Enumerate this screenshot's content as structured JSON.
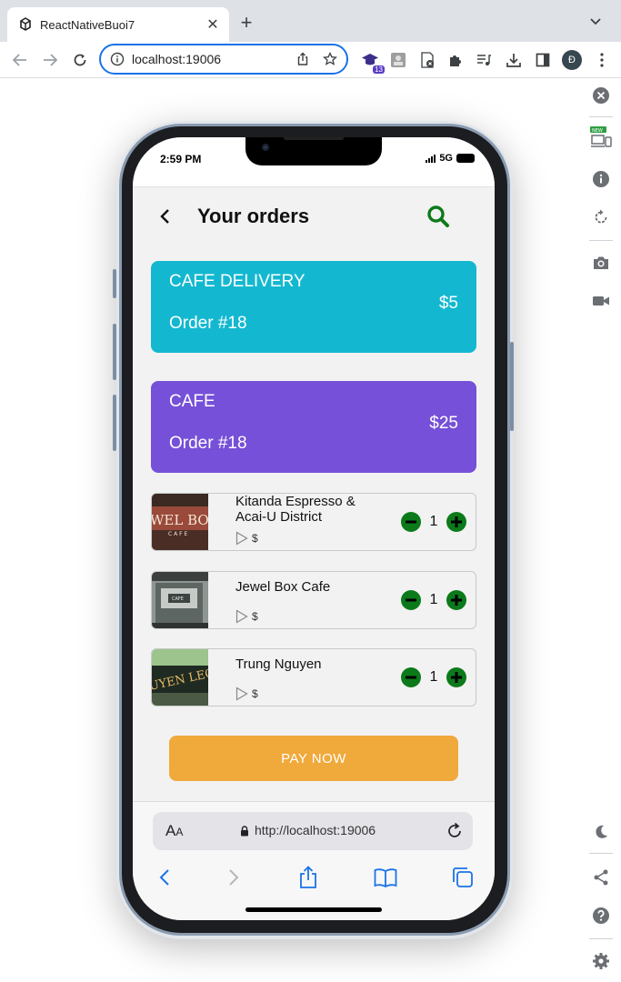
{
  "browser": {
    "tab_title": "ReactNativeBuoi7",
    "url": "localhost:19006",
    "extension_badge": "13",
    "profile_initial": "Đ",
    "devtools_new_badge": "NEW"
  },
  "phone": {
    "status_time": "2:59 PM",
    "network": "5G"
  },
  "app": {
    "title": "Your orders",
    "summary_cards": [
      {
        "name": "CAFE DELIVERY",
        "order": "Order #18",
        "amount": "$5",
        "color": "#13b8d0"
      },
      {
        "name": "CAFE",
        "order": "Order #18",
        "amount": "$25",
        "color": "#7650d8"
      }
    ],
    "items": [
      {
        "name": "Kitanda Espresso & Acai-U District",
        "price_tag": "$",
        "qty": "1"
      },
      {
        "name": "Jewel Box Cafe",
        "price_tag": "$",
        "qty": "1"
      },
      {
        "name": "Trung Nguyen",
        "price_tag": "$",
        "qty": "1"
      }
    ],
    "pay_button": "PAY NOW"
  },
  "safari": {
    "aa_label_big": "A",
    "aa_label_small": "A",
    "url": "http://localhost:19006"
  },
  "colors": {
    "accent_green": "#0c7a1a",
    "pay_orange": "#f0a93b",
    "ios_blue": "#1a73e8"
  }
}
